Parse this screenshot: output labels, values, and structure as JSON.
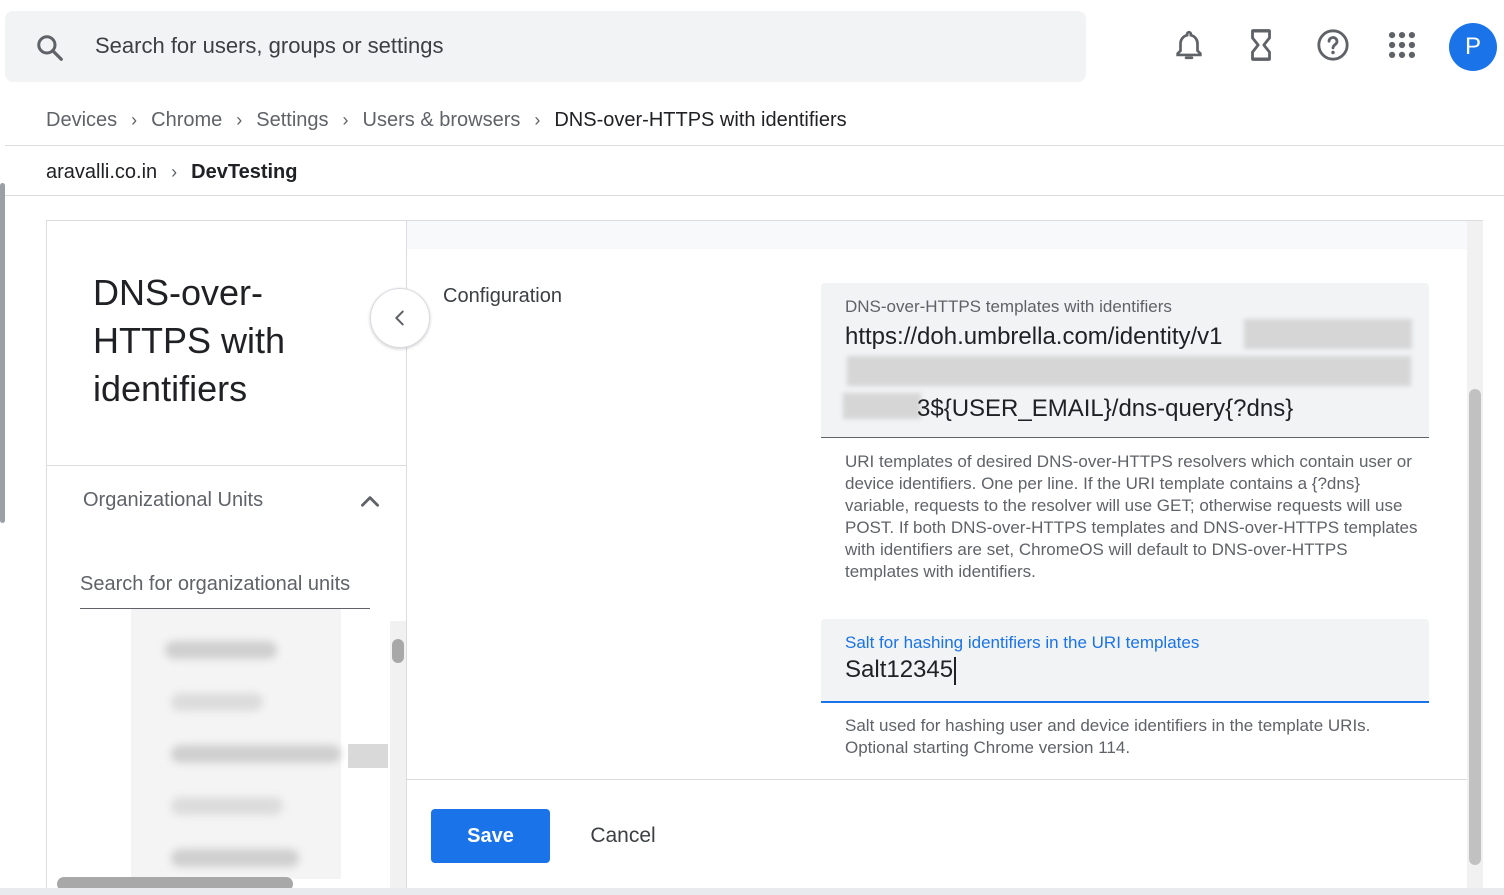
{
  "search": {
    "placeholder": "Search for users, groups or settings"
  },
  "topbar": {
    "icons": [
      "notifications-icon",
      "tasks-hourglass-icon",
      "help-icon",
      "apps-grid-icon"
    ],
    "avatar_letter": "P",
    "avatar_color": "#1a73e8"
  },
  "breadcrumbs": [
    "Devices",
    "Chrome",
    "Settings",
    "Users & browsers",
    "DNS-over-HTTPS with identifiers"
  ],
  "org_path": {
    "org": "aravalli.co.in",
    "current_ou": "DevTesting"
  },
  "left_panel": {
    "policy_title": "DNS-over-HTTPS with identifiers",
    "ou_section_title": "Organizational Units",
    "ou_search_placeholder": "Search for organizational units"
  },
  "config": {
    "section_label": "Configuration",
    "templates_field": {
      "label": "DNS-over-HTTPS templates with identifiers",
      "line1": "https://doh.umbrella.com/identity/v1",
      "line3": "3${USER_EMAIL}/dns-query{?dns}"
    },
    "templates_help": "URI templates of desired DNS-over-HTTPS resolvers which contain user or device identifiers. One per line. If the URI template contains a {?dns} variable, requests to the resolver will use GET; otherwise requests will use POST. If both DNS-over-HTTPS templates and DNS-over-HTTPS templates with identifiers are set, ChromeOS will default to DNS-over-HTTPS templates with identifiers.",
    "salt_field": {
      "label": "Salt for hashing identifiers in the URI templates",
      "value": "Salt12345"
    },
    "salt_help": "Salt used for hashing user and device identifiers in the template URIs. Optional starting Chrome version 114."
  },
  "actions": {
    "save": "Save",
    "cancel": "Cancel"
  },
  "colors": {
    "accent": "#1a73e8",
    "field_bg": "#f1f3f4"
  }
}
